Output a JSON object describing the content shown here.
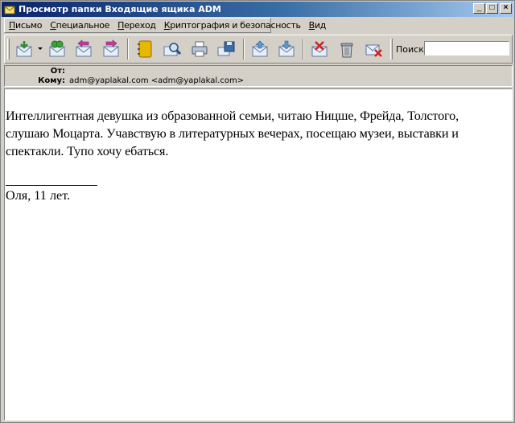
{
  "window": {
    "title": "Просмотр папки Входящие ящика ADM",
    "minimize_glyph": "_",
    "maximize_glyph": "□",
    "close_glyph": "×"
  },
  "menu": [
    {
      "label": "Письмо",
      "underline": "П",
      "rest": "исьмо"
    },
    {
      "label": "Специальное",
      "underline": "С",
      "rest": "пециальное"
    },
    {
      "label": "Переход",
      "underline": "П",
      "rest": "ереход"
    },
    {
      "label": "Криптография и безопасность",
      "underline": "К",
      "rest": "риптография и безопасность"
    },
    {
      "label": "Вид",
      "underline": "В",
      "rest": "ид"
    }
  ],
  "toolbar": {
    "search_label": "Поиск:",
    "search_value": "",
    "icons": [
      "get-mail-icon",
      "send-receive-icon",
      "reply-icon",
      "forward-icon",
      "address-book-icon",
      "find-icon",
      "print-icon",
      "save-icon",
      "previous-icon",
      "next-icon",
      "junk-icon",
      "trash-icon",
      "delete-icon"
    ]
  },
  "headers": {
    "from_label": "От:",
    "from_value": "",
    "to_label": "Кому:",
    "to_value": "adm@yaplakal.com <adm@yaplakal.com>"
  },
  "message": {
    "body": "Интеллигентная девушка из образованной семьи, читаю Ницше, Фрейда, Толстого, слушаю Моцарта. Учавствую в литературных вечерах, посещаю музеи, выставки и спектакли. Тупо хочу ебаться.",
    "signature": "Оля, 11 лет."
  },
  "colors": {
    "title_gradient_start": "#0a246a",
    "title_gradient_end": "#a6caf0",
    "chrome": "#d4d0c8"
  }
}
